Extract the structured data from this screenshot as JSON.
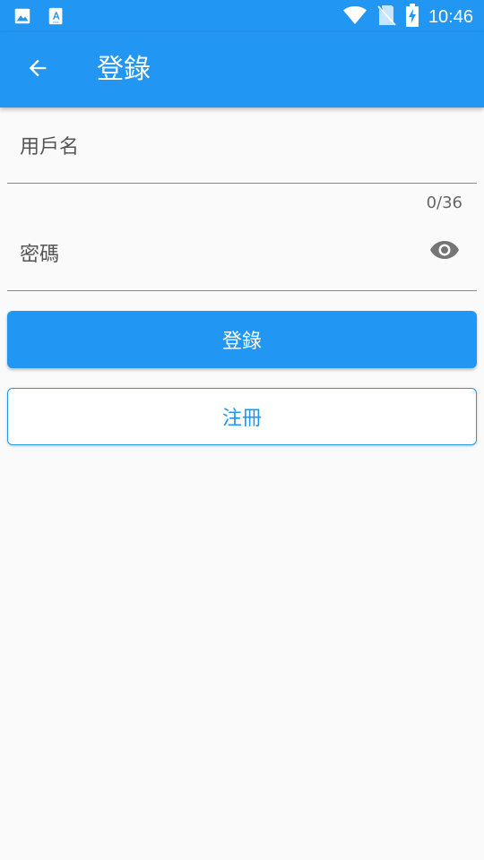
{
  "colors": {
    "primary": "#2196f3",
    "background": "#fafafa",
    "text_secondary": "#555555"
  },
  "status_bar": {
    "time": "10:46",
    "left_icons": [
      "image-icon",
      "font-download-icon"
    ],
    "right_icons": [
      "wifi-icon",
      "no-sim-icon",
      "battery-charging-icon"
    ]
  },
  "app_bar": {
    "back_icon": "arrow-back-icon",
    "title": "登錄"
  },
  "form": {
    "username": {
      "label": "用戶名",
      "value": "",
      "counter": "0/36"
    },
    "password": {
      "label": "密碼",
      "value": "",
      "visibility_icon": "eye-icon"
    }
  },
  "buttons": {
    "login_label": "登錄",
    "register_label": "注冊"
  }
}
